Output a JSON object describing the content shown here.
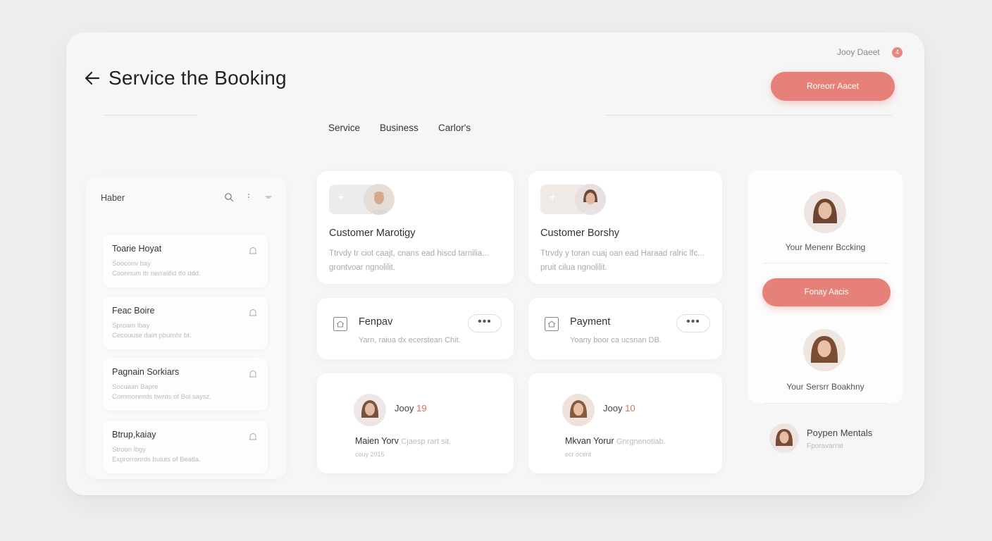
{
  "header": {
    "title": "Service the Booking",
    "user_name": "Jooy Daeet",
    "notification_count": "4",
    "primary_button": "Roreorr Aacet"
  },
  "tabs": [
    {
      "label": "Service"
    },
    {
      "label": "Business"
    },
    {
      "label": "Carlor's"
    }
  ],
  "left_panel": {
    "title": "Haber",
    "items": [
      {
        "title": "Toarie Hoyat",
        "sub": "Sooconv bay",
        "desc": "Coonnum ttr nerraiifid tfo ddd."
      },
      {
        "title": "Feac Boire",
        "sub": "Sproam lbay",
        "desc": "Cecouuse dairt pburnhr bt."
      },
      {
        "title": "Pagnain Sorkiars",
        "sub": "Socuaan Bapre",
        "desc": "Commonnrds tiwrds of Bol saysz."
      },
      {
        "title": "Btrup,kaiay",
        "sub": "Stroon lbgy",
        "desc": "Exprorronrds buiuts of Beatla."
      }
    ]
  },
  "booking_cards": [
    {
      "title": "Customer Marotigy",
      "desc": "Ttrvdy tr ciot caajt, cnans ead hiscd tarnilia... grontvoar ngnolilit."
    },
    {
      "title": "Customer Borshy",
      "desc": "Ttrvdy y toran cuaj oan ead Haraad ralric lfc... pruit cilua ngnolilit."
    }
  ],
  "payment_cards": [
    {
      "title": "Fenpav",
      "desc": "Yarn, raiua dx ecerstean Chit."
    },
    {
      "title": "Payment",
      "desc": "Yoany boor ca ucsnan DB."
    }
  ],
  "bottom_cards": [
    {
      "name": "Jooy",
      "num": "19",
      "sub": "Maien Yorv",
      "sub_faint": "Cjaesp rart sit.",
      "meta": "couy 2015"
    },
    {
      "name": "Jooy",
      "num": "10",
      "sub": "Mkvan Yorur",
      "sub_faint": "Gnrgnenotiab.",
      "meta": "ecr ocent"
    }
  ],
  "right_panel": {
    "label_1": "Your Menenr Bccking",
    "button": "Fonay Aacis",
    "label_2": "Your Sersrr Boakhny"
  },
  "footer_contact": {
    "title": "Poypen Mentals",
    "sub": "Fporavarrat"
  },
  "colors": {
    "accent": "#e58178",
    "accent_text": "#e06a5f",
    "window_bg": "#f6f6f6",
    "card_bg": "#ffffff"
  }
}
